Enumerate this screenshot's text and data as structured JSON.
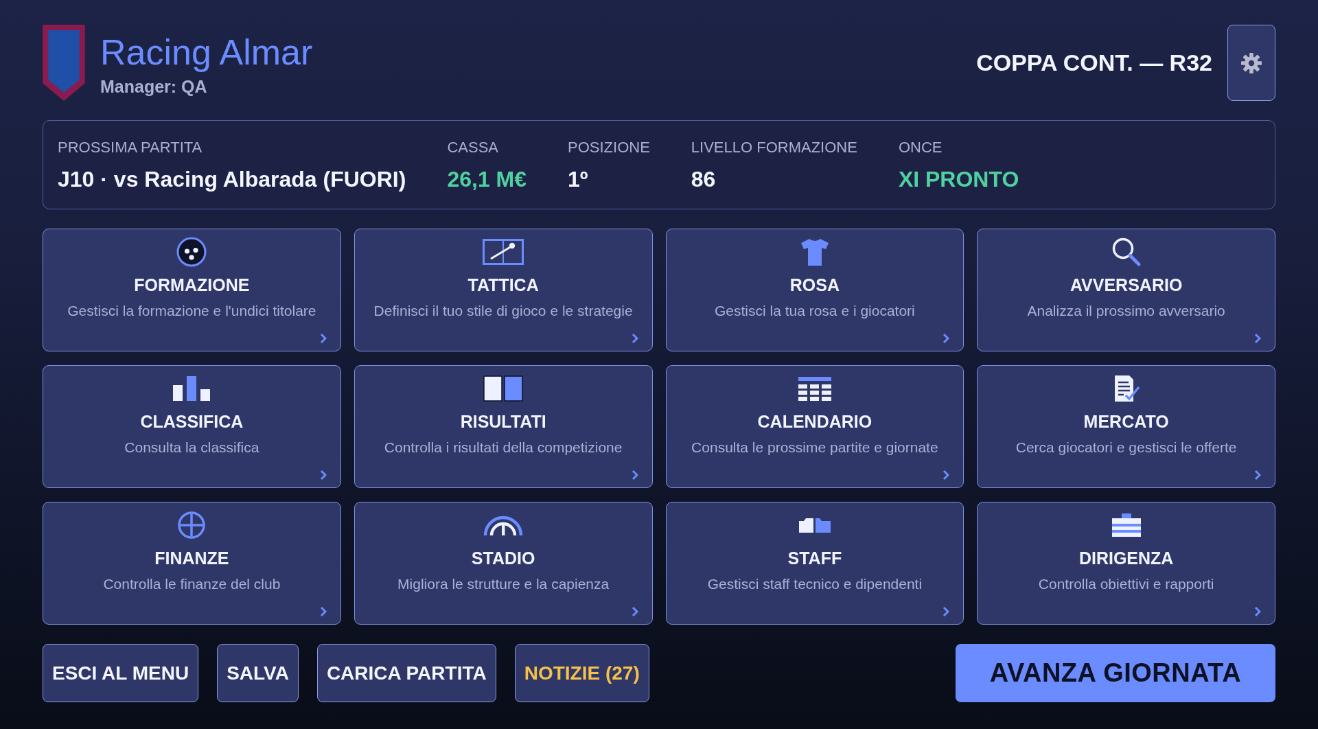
{
  "header": {
    "club_name": "Racing Almar",
    "manager": "Manager: QA",
    "competition": "COPPA CONT. — R32"
  },
  "summary": [
    {
      "label": "PROSSIMA PARTITA",
      "value": "J10 · vs Racing Albarada (FUORI)",
      "kind": "plain"
    },
    {
      "label": "CASSA",
      "value": "26,1 M€",
      "kind": "positive"
    },
    {
      "label": "POSIZIONE",
      "value": "1º",
      "kind": "plain"
    },
    {
      "label": "LIVELLO FORMAZIONE",
      "value": "86",
      "kind": "plain"
    },
    {
      "label": "ONCE",
      "value": "XI PRONTO",
      "kind": "positive"
    }
  ],
  "cards": [
    {
      "title": "FORMAZIONE",
      "description": "Gestisci la formazione e l'undici titolare"
    },
    {
      "title": "TATTICA",
      "description": "Definisci il tuo stile di gioco e le strategie"
    },
    {
      "title": "ROSA",
      "description": "Gestisci la tua rosa e i giocatori"
    },
    {
      "title": "AVVERSARIO",
      "description": "Analizza il prossimo avversario"
    },
    {
      "title": "CLASSIFICA",
      "description": "Consulta la classifica"
    },
    {
      "title": "RISULTATI",
      "description": "Controlla i risultati della competizione"
    },
    {
      "title": "CALENDARIO",
      "description": "Consulta le prossime partite e giornate"
    },
    {
      "title": "MERCATO",
      "description": "Cerca giocatori e gestisci le offerte"
    },
    {
      "title": "FINANZE",
      "description": "Controlla le finanze del club"
    },
    {
      "title": "STADIO",
      "description": "Migliora le strutture e la capienza"
    },
    {
      "title": "STAFF",
      "description": "Gestisci staff tecnico e dipendenti"
    },
    {
      "title": "DIRIGENZA",
      "description": "Controlla obiettivi e rapporti"
    }
  ],
  "buttons": [
    {
      "label": "ESCI AL MENU",
      "kind": "secondary"
    },
    {
      "label": "SALVA",
      "kind": "secondary"
    },
    {
      "label": "CARICA PARTITA",
      "kind": "secondary"
    },
    {
      "label": "NOTIZIE (27)",
      "kind": "news"
    },
    {
      "label": "AVANZA GIORNATA",
      "kind": "primary"
    }
  ]
}
